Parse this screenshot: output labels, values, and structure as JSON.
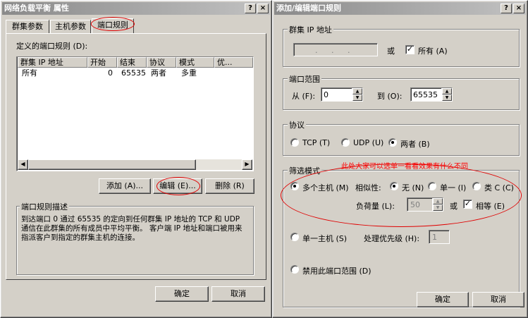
{
  "left_dialog": {
    "title": "网络负载平衡 属性",
    "help_btn": "?",
    "close_btn": "×",
    "tabs": [
      "群集参数",
      "主机参数",
      "端口规则"
    ],
    "port_rules_label": "定义的端口规则 (D):",
    "columns": [
      "群集 IP 地址",
      "开始",
      "结束",
      "协议",
      "模式",
      "优..."
    ],
    "row": [
      "所有",
      "0",
      "65535",
      "两者",
      "多重",
      ""
    ],
    "add_btn": "添加 (A)...",
    "edit_btn": "编辑 (E)...",
    "delete_btn": "删除 (R)",
    "desc_title": "端口规则描述",
    "desc_text": "到达端口 0 通过 65535 的定向到任何群集 IP 地址的 TCP 和 UDP 通信在此群集的所有成员中平均平衡。 客户端 IP 地址和端口被用来指派客户到指定的群集主机的连接。",
    "ok_btn": "确定",
    "cancel_btn": "取消"
  },
  "right_dialog": {
    "title": "添加/编辑端口规则",
    "help_btn": "?",
    "close_btn": "×",
    "cluster_ip_group": "群集 IP 地址",
    "ip_dots": ". . .",
    "or_label": "或",
    "all_label": "所有 (A)",
    "all_checked": true,
    "port_range_group": "端口范围",
    "from_label": "从 (F):",
    "from_value": "0",
    "to_label": "到 (O):",
    "to_value": "65535",
    "protocol_group": "协议",
    "proto_tcp": "TCP (T)",
    "proto_udp": "UDP (U)",
    "proto_both": "两者 (B)",
    "proto_selected": "both",
    "filter_group": "筛选模式",
    "multi_host": "多个主机 (M)",
    "affinity_label": "相似性:",
    "aff_none": "无 (N)",
    "aff_single": "单一 (I)",
    "aff_class": "类 C (C)",
    "load_label": "负荷量 (L):",
    "load_value": "50",
    "or_label2": "或",
    "equal_label": "相等 (E)",
    "equal_checked": true,
    "single_host": "单一主机 (S)",
    "priority_label": "处理优先级 (H):",
    "priority_value": "1",
    "disable_range": "禁用此端口范围 (D)",
    "ok_btn": "确定",
    "cancel_btn": "取消"
  },
  "annotation_text": "此处大家可以选单一看看效果有什么不同",
  "colors": {
    "annotation": "#ff0000",
    "face": "#d4d0c8"
  }
}
